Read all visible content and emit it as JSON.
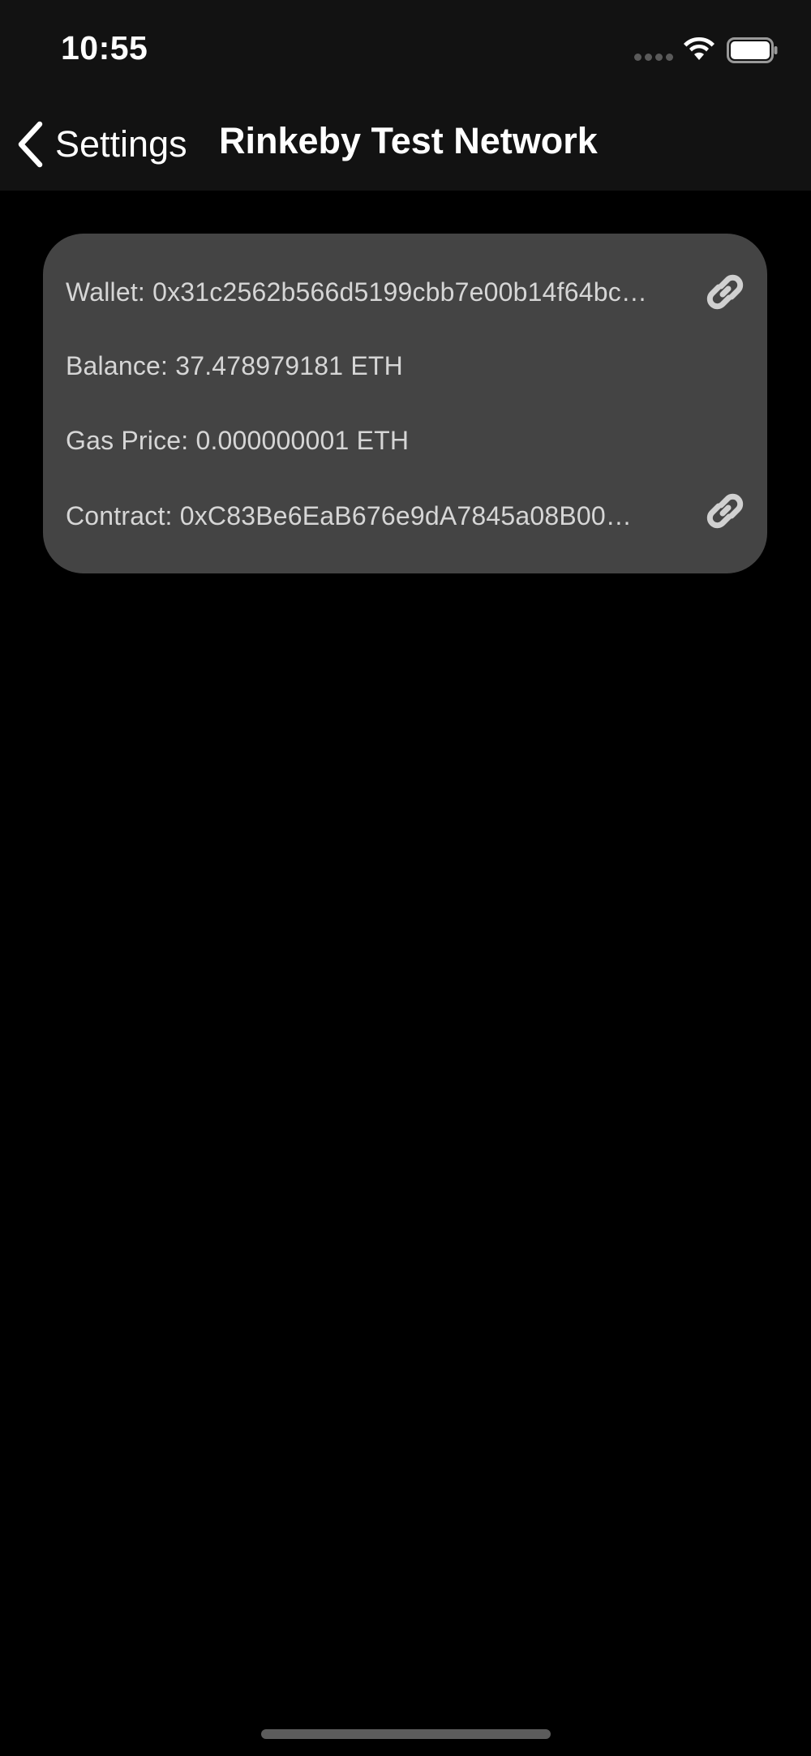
{
  "status_bar": {
    "time": "10:55",
    "icons": [
      "signal-dots-icon",
      "wifi-icon",
      "battery-icon"
    ]
  },
  "nav": {
    "back_label": "Settings",
    "back_icon": "chevron-left-icon",
    "title": "Rinkeby Test Network"
  },
  "card": {
    "wallet": {
      "text": "Wallet: 0x31c2562b566d5199cbb7e00b14f64bc…",
      "icon": "link-icon"
    },
    "balance": {
      "text": "Balance: 37.478979181 ETH"
    },
    "gas_price": {
      "text": "Gas Price: 0.000000001 ETH"
    },
    "contract": {
      "text": "Contract: 0xC83Be6EaB676e9dA7845a08B00…",
      "icon": "link-icon"
    }
  },
  "colors": {
    "top_bar": "#121212",
    "background": "#000000",
    "card": "#444444",
    "card_text": "#d6d6d6",
    "icon": "#d0d0d0"
  }
}
